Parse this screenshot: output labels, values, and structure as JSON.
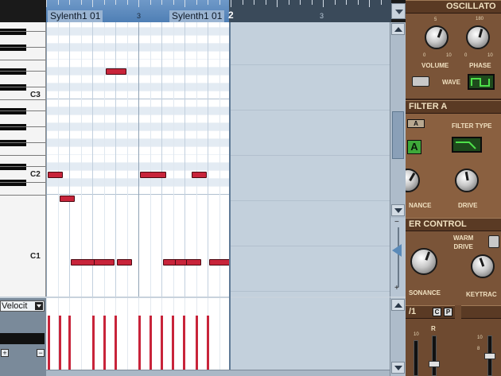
{
  "ruler": {
    "parts": [
      "Sylenth1 01",
      "Sylenth1 01"
    ],
    "bar_numbers": [
      "3",
      "2",
      "3"
    ]
  },
  "keyboard": {
    "labels": [
      "C3",
      "C2",
      "C1"
    ]
  },
  "piano_roll": {
    "note_color": "#c8243a"
  },
  "velocity": {
    "lane_selector": "Velocit",
    "add_button": "+",
    "remove_button": "−"
  },
  "synth": {
    "oscillator": {
      "title": "OSCILLATO",
      "volume_label": "VOLUME",
      "phase_label": "PHASE",
      "wave_label": "WAVE",
      "scale_vol_top": "5",
      "scale_phase_top": "180",
      "scale_zero": "0",
      "scale_ten": "10"
    },
    "filter_a": {
      "title": "FILTER A",
      "tab": "A",
      "filter_type_label": "FILTER TYPE",
      "selected": "A",
      "resonance_label": "NANCE",
      "drive_label": "DRIVE"
    },
    "filter_control": {
      "title": "ER CONTROL",
      "warm_drive_label": "WARM\nDRIVE",
      "resonance_label": "SONANCE",
      "keytrack_label": "KEYTRAC"
    },
    "bottom": {
      "title": "/1",
      "btn_c": "C",
      "btn_p": "P",
      "r_label": "R",
      "scale_10": "10",
      "scale_8": "8"
    }
  }
}
